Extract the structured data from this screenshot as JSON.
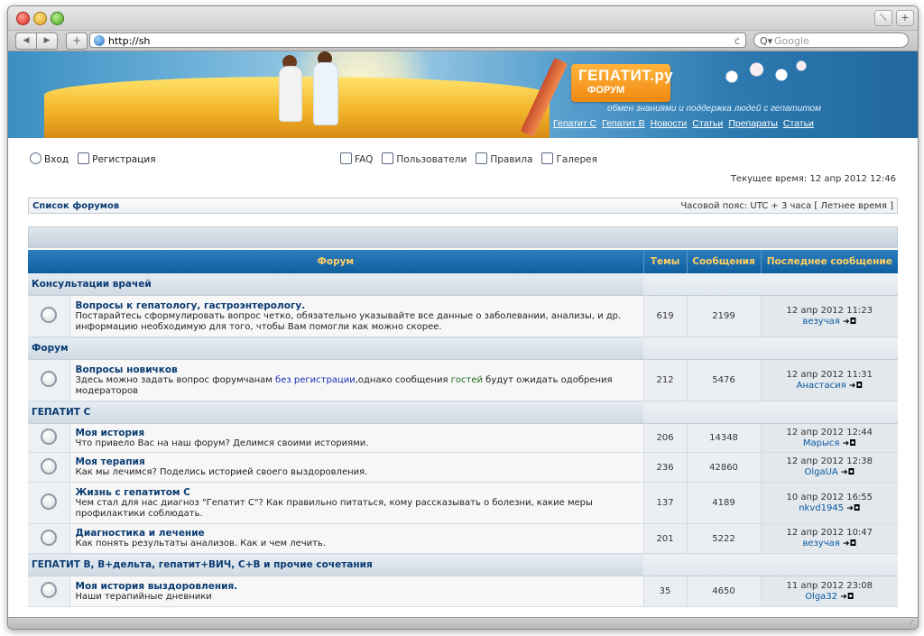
{
  "browser": {
    "address": "http://sh",
    "search_placeholder": "Google",
    "back": "◀",
    "forward": "▶",
    "add": "+",
    "reload": "ċ",
    "search_icon": "Q▾",
    "tb_resize": "⟍",
    "tb_plus": "+"
  },
  "banner": {
    "logo_main": "ГЕПАТИТ.ру",
    "logo_sub": "ФОРУМ",
    "tagline": "обмен знаниями и поддержка людей с гепатитом",
    "links": [
      "Гепатит С",
      "Гепатит В",
      "Новости",
      "Статьи",
      "Препараты",
      "Статьи"
    ]
  },
  "userbar": {
    "login": "Вход",
    "register": "Регистрация"
  },
  "centerbar": {
    "faq": "FAQ",
    "users": "Пользователи",
    "rules": "Правила",
    "gallery": "Галерея"
  },
  "time": "Текущее время: 12 апр 2012 12:46",
  "crumbs": {
    "home": "Список форумов",
    "timezone": "Часовой пояс: UTC + 3 часа [ Летнее время ]"
  },
  "table": {
    "headers": {
      "forum": "Форум",
      "topics": "Темы",
      "posts": "Сообщения",
      "last": "Последнее сообщение"
    },
    "cats": [
      "Консультации врачей",
      "Форум",
      "ГЕПАТИТ С",
      "ГЕПАТИТ В, В+дельта, гепатит+ВИЧ, С+В и прочие сочетания"
    ],
    "rows": [
      {
        "title": "Вопросы к гепатологу, гастроэнтерологу.",
        "desc": "Постарайтесь сформулировать вопрос четко, обязательно указывайте все данные о заболевании, анализы, и др. информацию необходимую для того, чтобы Вам помогли как можно скорее.",
        "topics": "619",
        "posts": "2199",
        "date": "12 апр 2012 11:23",
        "user": "везучая"
      },
      {
        "title": "Вопросы новичков",
        "desc_a": "Здесь можно задать вопрос форумчанам ",
        "desc_link1": "без регистрации",
        "desc_b": ",однако сообщения ",
        "desc_link2": "гостей",
        "desc_c": " будут ожидать одобрения модераторов",
        "topics": "212",
        "posts": "5476",
        "date": "12 апр 2012 11:31",
        "user": "Анастасия"
      },
      {
        "title": "Моя история",
        "desc": "Что привело Вас на наш форум? Делимся своими историями.",
        "topics": "206",
        "posts": "14348",
        "date": "12 апр 2012 12:44",
        "user": "Марыся"
      },
      {
        "title": "Моя терапия",
        "desc": "Как мы лечимся? Поделись историей своего выздоровления.",
        "topics": "236",
        "posts": "42860",
        "date": "12 апр 2012 12:38",
        "user": "OlgaUA"
      },
      {
        "title": "Жизнь с гепатитом С",
        "desc": "Чем стал для нас диагноз \"Гепатит С\"? Как правильно питаться, кому рассказывать о болезни, какие меры профилактики соблюдать.",
        "topics": "137",
        "posts": "4189",
        "date": "10 апр 2012 16:55",
        "user": "nkvd1945"
      },
      {
        "title": "Диагностика и лечение",
        "desc": "Как понять результаты анализов. Как и чем лечить.",
        "topics": "201",
        "posts": "5222",
        "date": "12 апр 2012 10:47",
        "user": "везучая"
      },
      {
        "title": "Моя история выздоровления.",
        "desc": "Наши терапийные дневники",
        "topics": "35",
        "posts": "4650",
        "date": "11 апр 2012 23:08",
        "user": "Olga32"
      }
    ],
    "arrow": "➜◘"
  }
}
